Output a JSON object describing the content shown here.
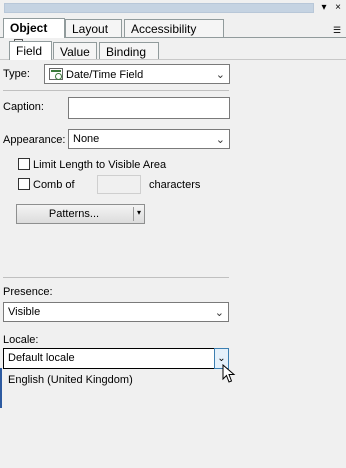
{
  "titlebar": {
    "menu_glyph": "▾",
    "close_glyph": "×"
  },
  "main_tabs": {
    "object": "Object",
    "layout": "Layout",
    "accessibility": "Accessibility"
  },
  "sub_tabs": {
    "field": "Field",
    "value": "Value",
    "binding": "Binding"
  },
  "form": {
    "type_label": "Type:",
    "type_value": "Date/Time Field",
    "caption_label": "Caption:",
    "caption_value": "",
    "appearance_label": "Appearance:",
    "appearance_value": "None",
    "limit_length_label": "Limit Length to Visible Area",
    "comb_of_label": "Comb of",
    "comb_of_value": "",
    "characters_label": "characters",
    "patterns_label": "Patterns...",
    "presence_label": "Presence:",
    "presence_value": "Visible",
    "locale_label": "Locale:",
    "locale_value": "Default locale",
    "locale_options": [
      "English (United Kingdom)"
    ]
  },
  "icons": {
    "chevron": "⌄",
    "dropdown_arrow": "▾",
    "close_x": "x"
  }
}
